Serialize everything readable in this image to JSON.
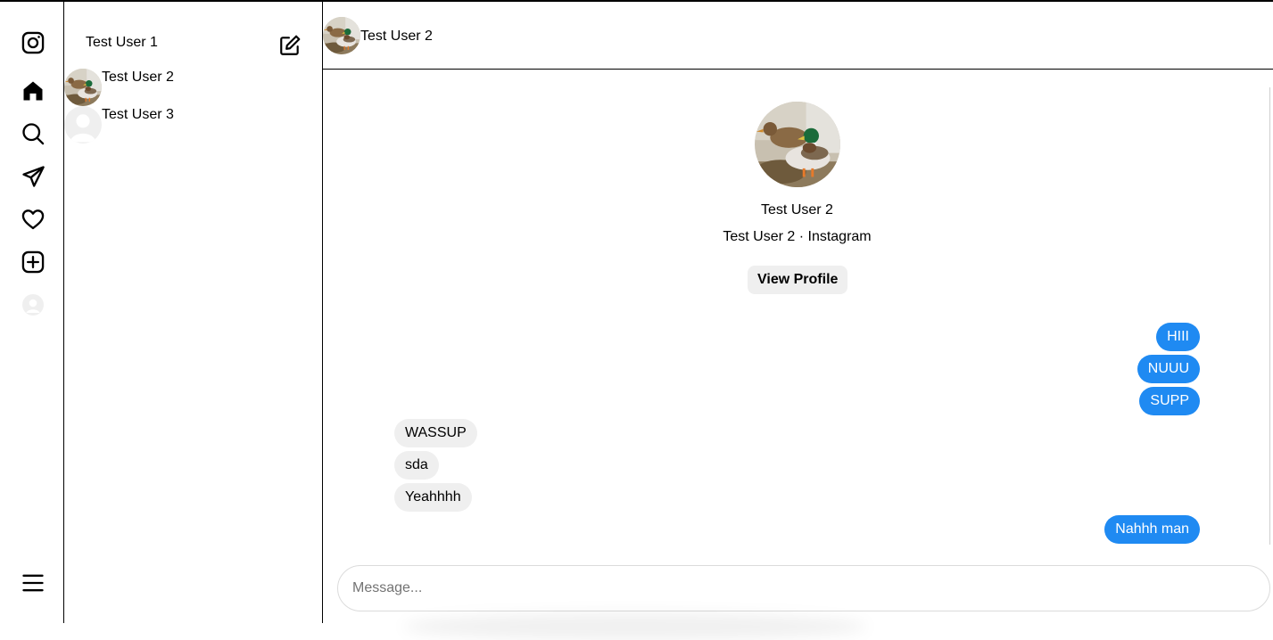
{
  "current_user": {
    "name": "Test User 1"
  },
  "nav": {
    "icons": [
      "instagram-logo",
      "home-icon",
      "search-icon",
      "messages-icon",
      "notifications-heart-icon",
      "create-plus-icon",
      "profile-avatar",
      "menu-icon"
    ]
  },
  "conversations": [
    {
      "name": "Test User 2",
      "avatar": "duck-photo",
      "selected": true
    },
    {
      "name": "Test User 3",
      "avatar": "default-avatar"
    }
  ],
  "chat": {
    "header_name": "Test User 2",
    "profile": {
      "name": "Test User 2",
      "subtitle": "Test User 2 · Instagram",
      "view_profile_label": "View Profile"
    },
    "messages": [
      {
        "text": "HIII",
        "direction": "outgoing"
      },
      {
        "text": "NUUU",
        "direction": "outgoing"
      },
      {
        "text": "SUPP",
        "direction": "outgoing"
      },
      {
        "text": "WASSUP",
        "direction": "incoming"
      },
      {
        "text": "sda",
        "direction": "incoming"
      },
      {
        "text": "Yeahhhh",
        "direction": "incoming"
      },
      {
        "text": "Nahhh man",
        "direction": "outgoing"
      }
    ],
    "composer": {
      "placeholder": "Message..."
    }
  },
  "colors": {
    "outgoing_bubble": "#1f8af2",
    "incoming_bubble": "#efefef",
    "button_bg": "#efefef",
    "border": "#000000"
  }
}
